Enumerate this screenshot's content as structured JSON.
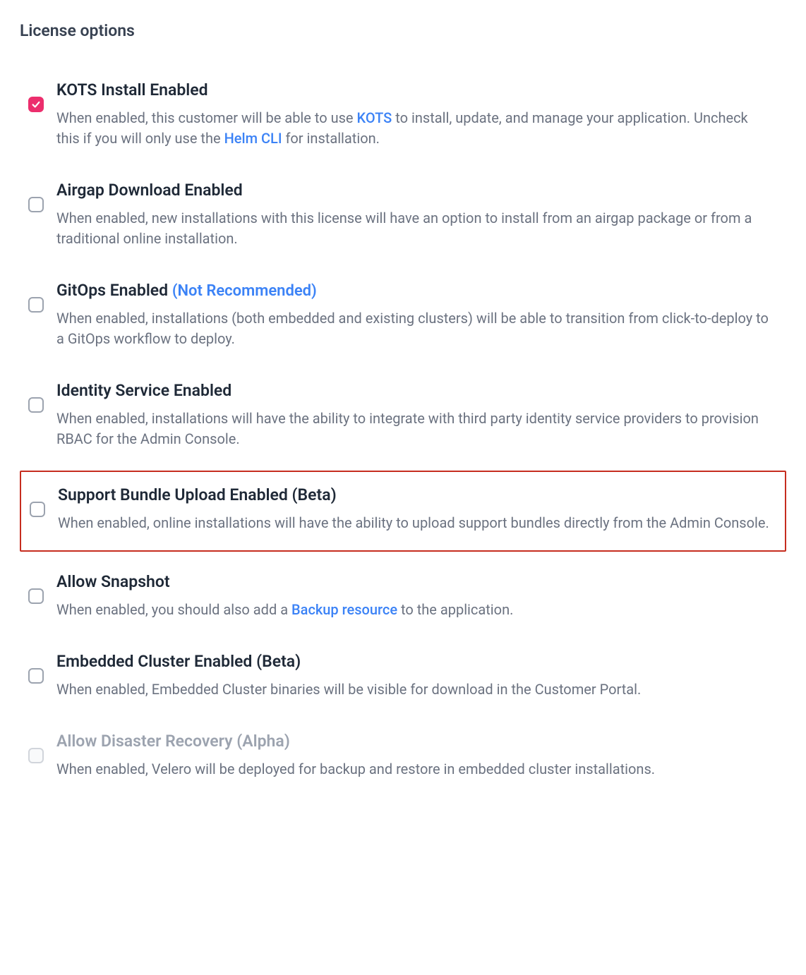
{
  "section_title": "License options",
  "options": [
    {
      "id": "kots-install",
      "title": "KOTS Install Enabled",
      "checked": true,
      "disabled": false,
      "highlighted": false,
      "dimmed": false,
      "desc_parts": [
        {
          "t": "text",
          "v": "When enabled, this customer will be able to use "
        },
        {
          "t": "link",
          "v": "KOTS"
        },
        {
          "t": "text",
          "v": " to install, update, and manage your application. Uncheck this if you will only use the "
        },
        {
          "t": "link",
          "v": "Helm CLI"
        },
        {
          "t": "text",
          "v": " for installation."
        }
      ]
    },
    {
      "id": "airgap-download",
      "title": "Airgap Download Enabled",
      "checked": false,
      "disabled": false,
      "highlighted": false,
      "dimmed": false,
      "desc_parts": [
        {
          "t": "text",
          "v": "When enabled, new installations with this license will have an option to install from an airgap package or from a traditional online installation."
        }
      ]
    },
    {
      "id": "gitops",
      "title": "GitOps Enabled",
      "title_suffix_link": "(Not Recommended)",
      "checked": false,
      "disabled": false,
      "highlighted": false,
      "dimmed": false,
      "desc_parts": [
        {
          "t": "text",
          "v": "When enabled, installations (both embedded and existing clusters) will be able to transition from click-to-deploy to a GitOps workflow to deploy."
        }
      ]
    },
    {
      "id": "identity-service",
      "title": "Identity Service Enabled",
      "checked": false,
      "disabled": false,
      "highlighted": false,
      "dimmed": false,
      "desc_parts": [
        {
          "t": "text",
          "v": "When enabled, installations will have the ability to integrate with third party identity service providers to provision RBAC for the Admin Console."
        }
      ]
    },
    {
      "id": "support-bundle-upload",
      "title": "Support Bundle Upload Enabled (Beta)",
      "checked": false,
      "disabled": false,
      "highlighted": true,
      "dimmed": false,
      "desc_parts": [
        {
          "t": "text",
          "v": "When enabled, online installations will have the ability to upload support bundles directly from the Admin Console."
        }
      ]
    },
    {
      "id": "allow-snapshot",
      "title": "Allow Snapshot",
      "checked": false,
      "disabled": false,
      "highlighted": false,
      "dimmed": false,
      "desc_parts": [
        {
          "t": "text",
          "v": "When enabled, you should also add a "
        },
        {
          "t": "link",
          "v": "Backup resource"
        },
        {
          "t": "text",
          "v": " to the application."
        }
      ]
    },
    {
      "id": "embedded-cluster",
      "title": "Embedded Cluster Enabled (Beta)",
      "checked": false,
      "disabled": false,
      "highlighted": false,
      "dimmed": false,
      "desc_parts": [
        {
          "t": "text",
          "v": "When enabled, Embedded Cluster binaries will be visible for download in the Customer Portal."
        }
      ]
    },
    {
      "id": "allow-disaster-recovery",
      "title": "Allow Disaster Recovery (Alpha)",
      "checked": false,
      "disabled": true,
      "highlighted": false,
      "dimmed": true,
      "desc_parts": [
        {
          "t": "text",
          "v": "When enabled, Velero will be deployed for backup and restore in embedded cluster installations."
        }
      ]
    }
  ]
}
